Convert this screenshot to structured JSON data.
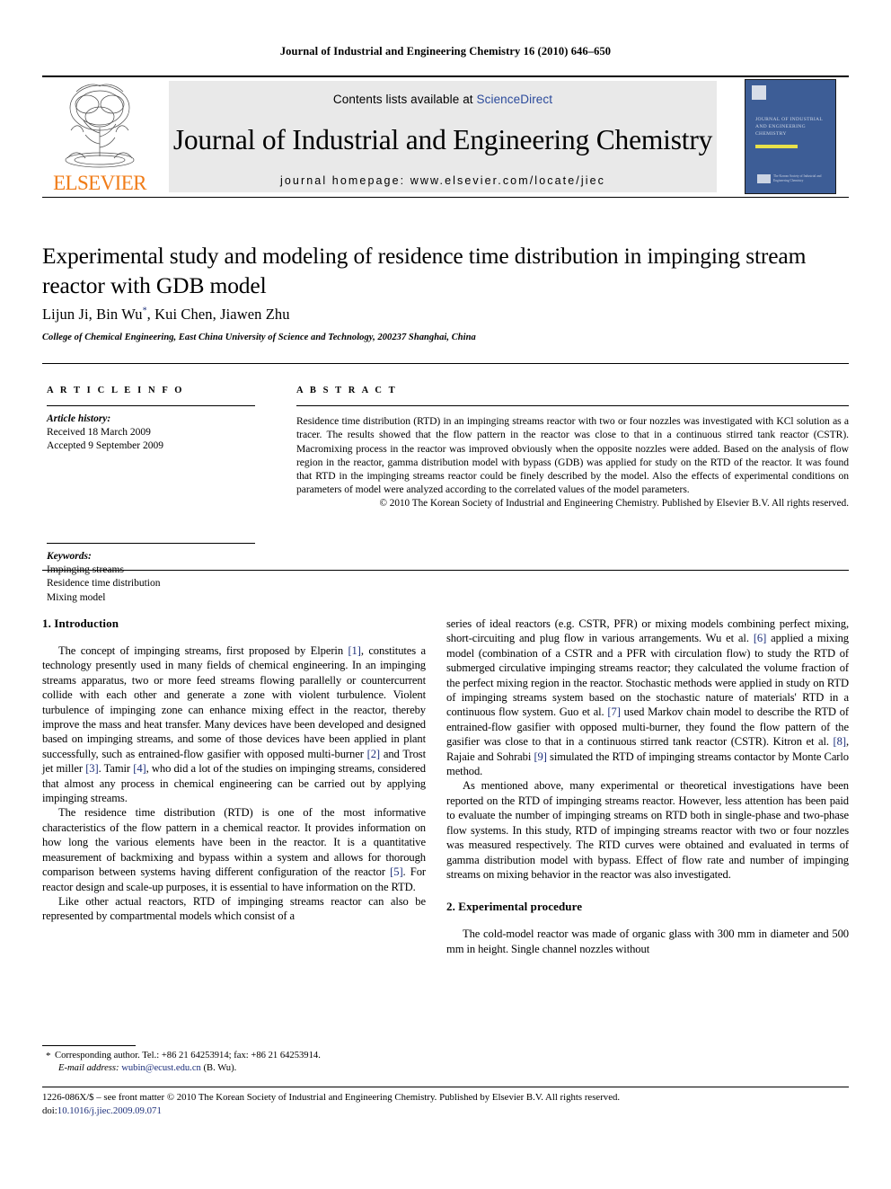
{
  "running_head": "Journal of Industrial and Engineering Chemistry 16 (2010) 646–650",
  "masthead": {
    "contents_prefix": "Contents lists available at ",
    "sciencedirect": "ScienceDirect",
    "journal_title": "Journal of Industrial and Engineering Chemistry",
    "homepage": "journal homepage: www.elsevier.com/locate/jiec",
    "publisher_wordmark": "ELSEVIER",
    "cover_title": "JOURNAL OF INDUSTRIAL AND ENGINEERING CHEMISTRY",
    "cover_society": "The Korean Society of Industrial and Engineering Chemistry",
    "accent_blue": "#2b4a9b",
    "elsevier_orange": "#F07C18",
    "cover_background": "#3d5d96",
    "banner_background": "#e9e9e9"
  },
  "article": {
    "title": "Experimental study and modeling of residence time distribution in impinging stream reactor with GDB model",
    "authors": "Lijun Ji, Bin Wu",
    "authors_tail": ", Kui Chen, Jiawen Zhu",
    "corresponding_marker": "*",
    "affiliation": "College of Chemical Engineering, East China University of Science and Technology, 200237 Shanghai, China"
  },
  "article_info": {
    "heading": "A R T I C L E  I N F O",
    "history_label": "Article history:",
    "received": "Received 18 March 2009",
    "accepted": "Accepted 9 September 2009",
    "keywords_label": "Keywords:",
    "keywords": [
      "Impinging streams",
      "Residence time distribution",
      "Mixing model"
    ]
  },
  "abstract": {
    "heading": "A B S T R A C T",
    "text": "Residence time distribution (RTD) in an impinging streams reactor with two or four nozzles was investigated with KCl solution as a tracer. The results showed that the flow pattern in the reactor was close to that in a continuous stirred tank reactor (CSTR). Macromixing process in the reactor was improved obviously when the opposite nozzles were added. Based on the analysis of flow region in the reactor, gamma distribution model with bypass (GDB) was applied for study on the RTD of the reactor. It was found that RTD in the impinging streams reactor could be finely described by the model. Also the effects of experimental conditions on parameters of model were analyzed according to the correlated values of the model parameters.",
    "copyright": "© 2010 The Korean Society of Industrial and Engineering Chemistry. Published by Elsevier B.V. All rights reserved."
  },
  "body": {
    "section1_heading": "1. Introduction",
    "section2_heading": "2. Experimental procedure",
    "left_p1_a": "The concept of impinging streams, first proposed by Elperin ",
    "left_p1_ref1": "[1]",
    "left_p1_b": ", constitutes a technology presently used in many fields of chemical engineering. In an impinging streams apparatus, two or more feed streams flowing parallelly or countercurrent collide with each other and generate a zone with violent turbulence. Violent turbulence of impinging zone can enhance mixing effect in the reactor, thereby improve the mass and heat transfer. Many devices have been developed and designed based on impinging streams, and some of those devices have been applied in plant successfully, such as entrained-flow gasifier with opposed multi-burner ",
    "left_p1_ref2": "[2]",
    "left_p1_c": " and Trost jet miller ",
    "left_p1_ref3": "[3]",
    "left_p1_d": ". Tamir ",
    "left_p1_ref4": "[4]",
    "left_p1_e": ", who did a lot of the studies on impinging streams, considered that almost any process in chemical engineering can be carried out by applying impinging streams.",
    "left_p2_a": "The residence time distribution (RTD) is one of the most informative characteristics of the flow pattern in a chemical reactor. It provides information on how long the various elements have been in the reactor. It is a quantitative measurement of backmixing and bypass within a system and allows for thorough comparison between systems having different configuration of the reactor ",
    "left_p2_ref5": "[5]",
    "left_p2_b": ". For reactor design and scale-up purposes, it is essential to have information on the RTD.",
    "left_p3": "Like other actual reactors, RTD of impinging streams reactor can also be represented by compartmental models which consist of a",
    "right_p1_a": "series of ideal reactors (e.g. CSTR, PFR) or mixing models combining perfect mixing, short-circuiting and plug flow in various arrangements. Wu et al. ",
    "right_p1_ref6": "[6]",
    "right_p1_b": " applied a mixing model (combination of a CSTR and a PFR with circulation flow) to study the RTD of submerged circulative impinging streams reactor; they calculated the volume fraction of the perfect mixing region in the reactor. Stochastic methods were applied in study on RTD of impinging streams system based on the stochastic nature of materials' RTD in a continuous flow system. Guo et al. ",
    "right_p1_ref7": "[7]",
    "right_p1_c": " used Markov chain model to describe the RTD of entrained-flow gasifier with opposed multi-burner, they found the flow pattern of the gasifier was close to that in a continuous stirred tank reactor (CSTR). Kitron et al. ",
    "right_p1_ref8": "[8]",
    "right_p1_d": ", Rajaie and Sohrabi ",
    "right_p1_ref9": "[9]",
    "right_p1_e": " simulated the RTD of impinging streams contactor by Monte Carlo method.",
    "right_p2": "As mentioned above, many experimental or theoretical investigations have been reported on the RTD of impinging streams reactor. However, less attention has been paid to evaluate the number of impinging streams on RTD both in single-phase and two-phase flow systems. In this study, RTD of impinging streams reactor with two or four nozzles was measured respectively. The RTD curves were obtained and evaluated in terms of gamma distribution model with bypass. Effect of flow rate and number of impinging streams on mixing behavior in the reactor was also investigated.",
    "right_p3": "The cold-model reactor was made of organic glass with 300 mm in diameter and 500 mm in height. Single channel nozzles without"
  },
  "footnote": {
    "marker": "*",
    "line1": "Corresponding author. Tel.: +86 21 64253914; fax: +86 21 64253914.",
    "email_label": "E-mail address:",
    "email": "wubin@ecust.edu.cn",
    "email_owner": "(B. Wu)."
  },
  "footer": {
    "line1": "1226-086X/$ – see front matter © 2010 The Korean Society of Industrial and Engineering Chemistry. Published by Elsevier B.V. All rights reserved.",
    "doi_label": "doi:",
    "doi": "10.1016/j.jiec.2009.09.071"
  }
}
